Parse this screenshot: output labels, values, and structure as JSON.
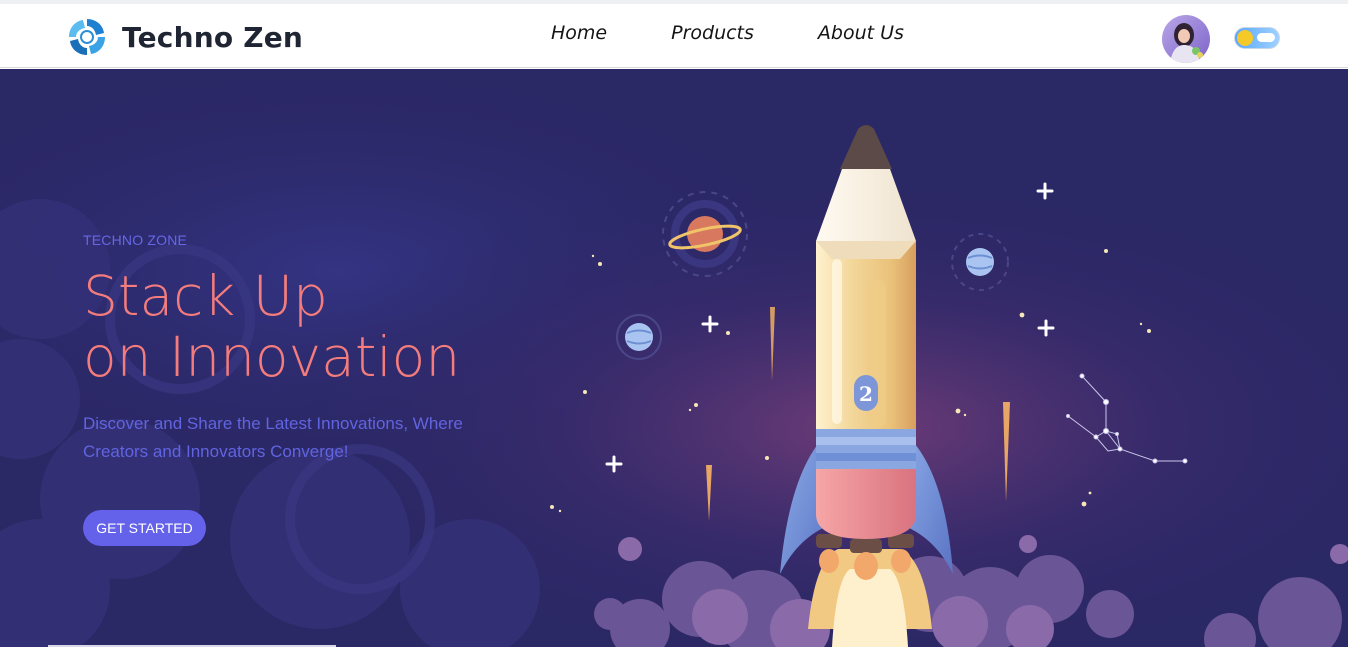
{
  "brand": {
    "name": "Techno Zen",
    "logo_icon": "swirl-logo-icon"
  },
  "nav": {
    "items": [
      {
        "label": "Home"
      },
      {
        "label": "Products"
      },
      {
        "label": "About Us"
      }
    ]
  },
  "header": {
    "avatar_icon": "user-avatar",
    "theme_toggle_icon": "sun-cloud-toggle-icon"
  },
  "hero": {
    "eyebrow": "TECHNO ZONE",
    "headline_line1": "Stack Up",
    "headline_line2": "on Innovation",
    "subtitle": "Discover and Share the Latest Innovations, Where Creators and Innovators Converge!",
    "cta_label": "GET STARTED",
    "illustration": "pencil-rocket-icon",
    "rocket_number": "2"
  },
  "colors": {
    "hero_bg": "#2a2664",
    "eyebrow": "#6667e6",
    "headline": "#f47c7c",
    "subtitle": "#6164e0",
    "button": "#6462ea"
  }
}
